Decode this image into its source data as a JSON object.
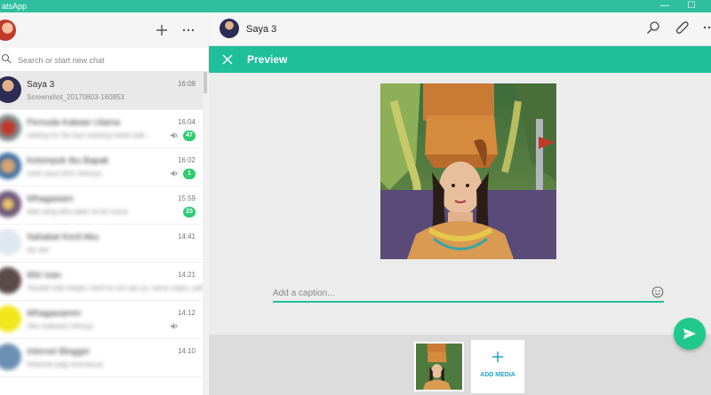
{
  "window": {
    "title": "atsApp"
  },
  "colors": {
    "accent": "#1fbf9a",
    "titlebar": "#2fbf9e",
    "badge": "#2ecc71",
    "send": "#21c88d"
  },
  "search": {
    "placeholder": "Search or start new chat"
  },
  "chats": [
    {
      "name": "Saya 3",
      "preview": "Screenshot_20170803-160853",
      "time": "16:09",
      "badge": "",
      "muted": false,
      "active": true,
      "blurred": false
    },
    {
      "name": "Pemuda Kalwan Utama",
      "preview": "waiting for the last meeting Indah bak...",
      "time": "16:04",
      "badge": "47",
      "muted": true,
      "active": false,
      "blurred": true
    },
    {
      "name": "Kelompok Ibu Bapak",
      "preview": "nanti saya kirim fotonya",
      "time": "16:02",
      "badge": "1",
      "muted": true,
      "active": false,
      "blurred": true
    },
    {
      "name": "Whagasiam",
      "preview": "Ada yang tahu jalan ini ke mana",
      "time": "15:59",
      "badge": "23",
      "muted": false,
      "active": false,
      "blurred": true
    },
    {
      "name": "Sahabat Kecil Aku",
      "preview": "sip oke",
      "time": "14:41",
      "badge": "",
      "muted": false,
      "active": false,
      "blurred": true
    },
    {
      "name": "Wiri Isan",
      "preview": "Yaudah kalo begitu nanti ke sini aja ya, sama siapa, pak?",
      "time": "14:21",
      "badge": "",
      "muted": false,
      "active": false,
      "blurred": true
    },
    {
      "name": "Whagasiamm",
      "preview": "Oke makasih infonya",
      "time": "14:12",
      "badge": "",
      "muted": true,
      "active": false,
      "blurred": true
    },
    {
      "name": "Internet Blogger",
      "preview": "Selamat pagi semuanya",
      "time": "14:10",
      "badge": "",
      "muted": false,
      "active": false,
      "blurred": true
    }
  ],
  "chat_header": {
    "contact_name": "Saya 3"
  },
  "preview": {
    "title": "Preview"
  },
  "caption": {
    "placeholder": "Add a caption..."
  },
  "tray": {
    "add_media_label": "ADD MEDIA"
  },
  "icons": {
    "new_chat": "plus-icon",
    "menu": "more-icon",
    "search": "search-icon",
    "attach": "paperclip-icon",
    "close": "close-icon",
    "emoji": "emoji-icon",
    "send": "send-icon"
  }
}
